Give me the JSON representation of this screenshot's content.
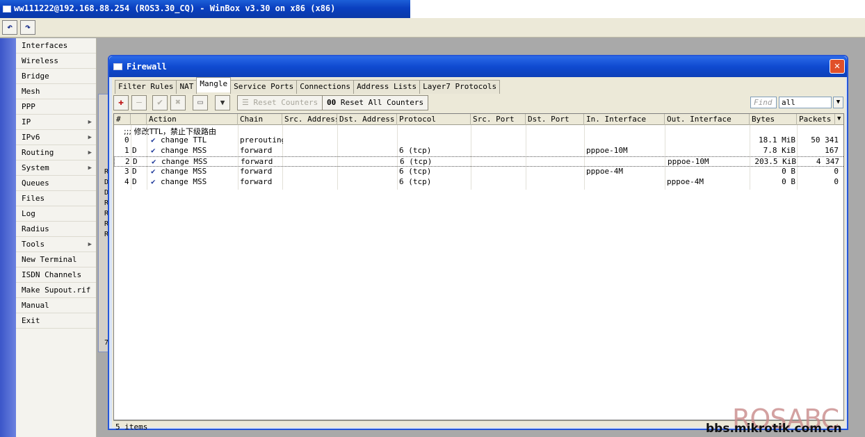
{
  "window": {
    "title": "ww111222@192.168.88.254 (ROS3.30_CQ) - WinBox v3.30 on x86 (x86)"
  },
  "toolbar": {
    "undo_icon": "undo-icon",
    "redo_icon": "redo-icon"
  },
  "menu": {
    "items": [
      {
        "label": "Interfaces",
        "submenu": false
      },
      {
        "label": "Wireless",
        "submenu": false
      },
      {
        "label": "Bridge",
        "submenu": false
      },
      {
        "label": "Mesh",
        "submenu": false
      },
      {
        "label": "PPP",
        "submenu": false
      },
      {
        "label": "IP",
        "submenu": true
      },
      {
        "label": "IPv6",
        "submenu": true
      },
      {
        "label": "Routing",
        "submenu": true
      },
      {
        "label": "System",
        "submenu": true
      },
      {
        "label": "Queues",
        "submenu": false
      },
      {
        "label": "Files",
        "submenu": false
      },
      {
        "label": "Log",
        "submenu": false
      },
      {
        "label": "Radius",
        "submenu": false
      },
      {
        "label": "Tools",
        "submenu": true
      },
      {
        "label": "New Terminal",
        "submenu": false
      },
      {
        "label": "ISDN Channels",
        "submenu": false
      },
      {
        "label": "Make Supout.rif",
        "submenu": false
      },
      {
        "label": "Manual",
        "submenu": false
      },
      {
        "label": "Exit",
        "submenu": false
      }
    ]
  },
  "background_window": {
    "letters": [
      "R",
      "D",
      "D",
      "R",
      "R",
      "R",
      "R"
    ],
    "bottom_char": "7"
  },
  "firewall": {
    "title": "Firewall",
    "close_symbol": "✕",
    "tabs": [
      "Filter Rules",
      "NAT",
      "Mangle",
      "Service Ports",
      "Connections",
      "Address Lists",
      "Layer7 Protocols"
    ],
    "active_tab": "Mangle",
    "buttons": {
      "add": "✚",
      "remove": "—",
      "enable": "✔",
      "disable": "✖",
      "comment": "▭",
      "filter": "▼",
      "reset_counters": "Reset Counters",
      "reset_all_counters": "Reset All Counters",
      "reset_all_prefix": "00"
    },
    "find_placeholder": "Find",
    "filter_value": "all",
    "columns": [
      "#",
      "",
      "Action",
      "Chain",
      "Src. Address",
      "Dst. Address",
      "Protocol",
      "Src. Port",
      "Dst. Port",
      "In. Interface",
      "Out. Interface",
      "Bytes",
      "Packets"
    ],
    "comment": ";;; 修改TTL，禁止下级路由",
    "rows": [
      {
        "num": "0",
        "flag": "",
        "action": "change TTL",
        "chain": "prerouting",
        "protocol": "",
        "in_if": "",
        "out_if": "",
        "bytes": "18.1 MiB",
        "packets": "50 341"
      },
      {
        "num": "1",
        "flag": "D",
        "action": "change MSS",
        "chain": "forward",
        "protocol": "6 (tcp)",
        "in_if": "pppoe-10M",
        "out_if": "",
        "bytes": "7.8 KiB",
        "packets": "167"
      },
      {
        "num": "2",
        "flag": "D",
        "action": "change MSS",
        "chain": "forward",
        "protocol": "6 (tcp)",
        "in_if": "",
        "out_if": "pppoe-10M",
        "bytes": "203.5 KiB",
        "packets": "4 347"
      },
      {
        "num": "3",
        "flag": "D",
        "action": "change MSS",
        "chain": "forward",
        "protocol": "6 (tcp)",
        "in_if": "pppoe-4M",
        "out_if": "",
        "bytes": "0 B",
        "packets": "0"
      },
      {
        "num": "4",
        "flag": "D",
        "action": "change MSS",
        "chain": "forward",
        "protocol": "6 (tcp)",
        "in_if": "",
        "out_if": "pppoe-4M",
        "bytes": "0 B",
        "packets": "0"
      }
    ],
    "selected_row": 2,
    "status": "5 items"
  },
  "watermark": {
    "brand": "ROSABC",
    "site": "bbs.mikrotik.com.cn"
  }
}
